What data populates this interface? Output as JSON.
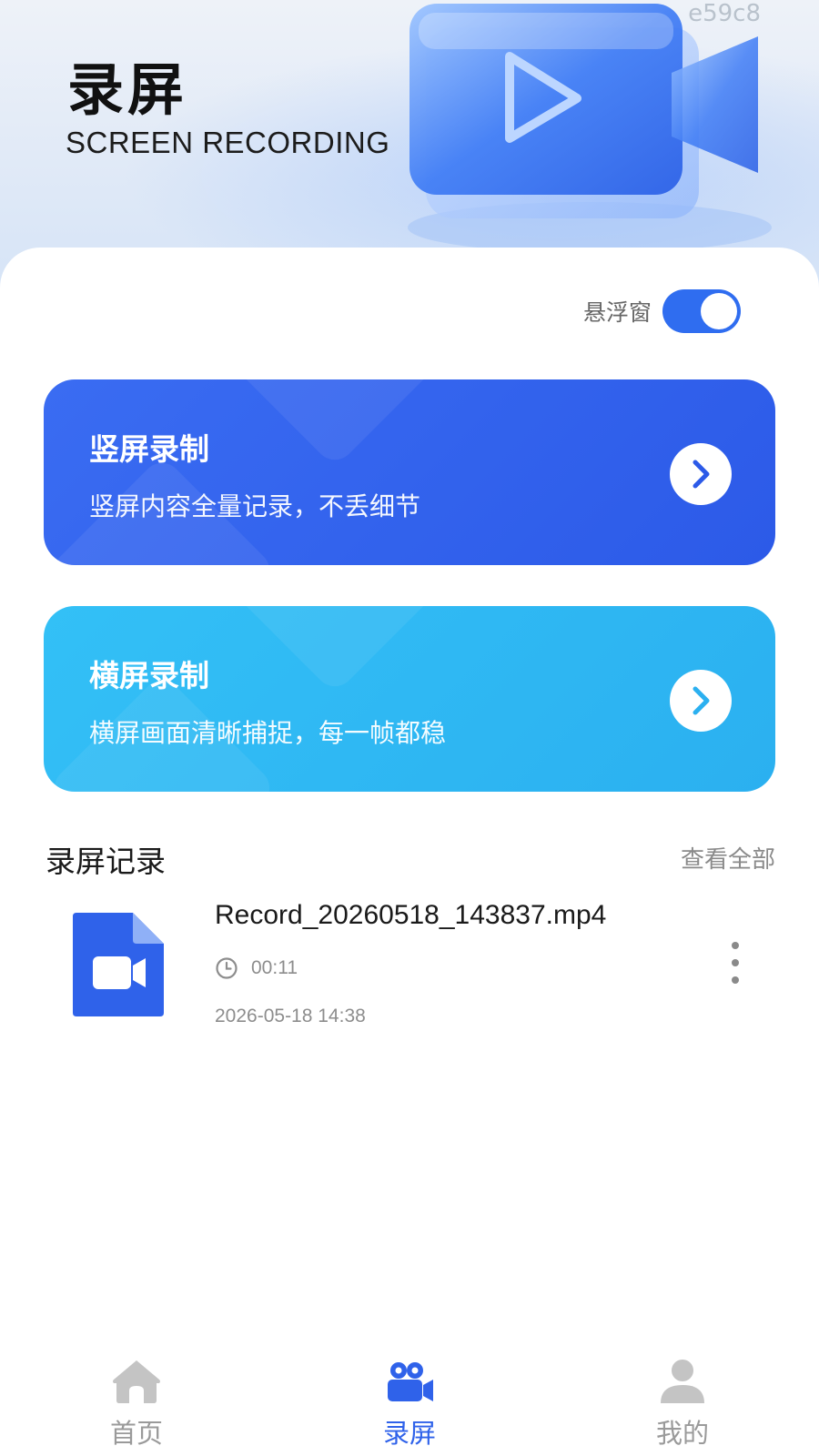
{
  "header": {
    "code": "e59c8",
    "title": "录屏",
    "subtitle": "SCREEN RECORDING"
  },
  "floating_window": {
    "label": "悬浮窗",
    "enabled": true
  },
  "cards": {
    "portrait": {
      "title": "竖屏录制",
      "description": "竖屏内容全量记录，不丢细节",
      "color": "#3464f0"
    },
    "landscape": {
      "title": "横屏录制",
      "description": "横屏画面清晰捕捉，每一帧都稳",
      "color": "#2fb8f4"
    }
  },
  "records": {
    "section_title": "录屏记录",
    "view_all": "查看全部",
    "items": [
      {
        "file_name": "Record_20260518_143837.mp4",
        "duration": "00:11",
        "date": "2026-05-18 14:38",
        "icon": "video-file-icon"
      }
    ]
  },
  "nav": {
    "items": [
      {
        "label": "首页",
        "icon": "home-icon",
        "active": false
      },
      {
        "label": "录屏",
        "icon": "video-camera-icon",
        "active": true
      },
      {
        "label": "我的",
        "icon": "user-icon",
        "active": false
      }
    ],
    "active_color": "#2f62ea",
    "inactive_color": "#c4c4c4"
  }
}
